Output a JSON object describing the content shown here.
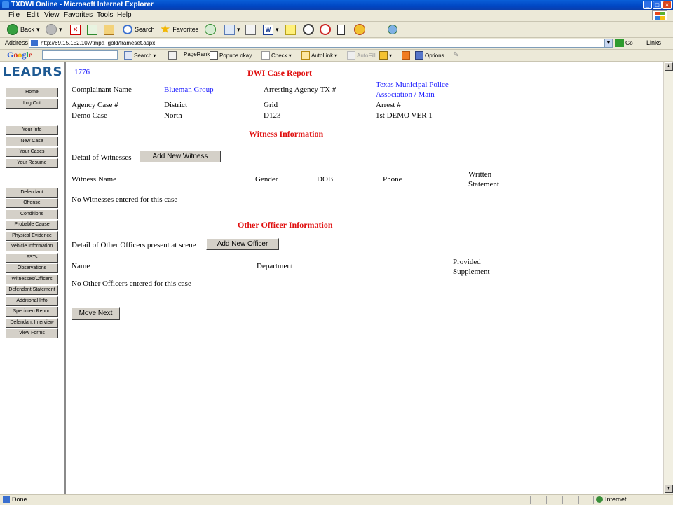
{
  "window": {
    "title": "TXDWI Online - Microsoft Internet Explorer",
    "min": "_",
    "max": "□",
    "close": "×"
  },
  "menu": [
    "File",
    "Edit",
    "View",
    "Favorites",
    "Tools",
    "Help"
  ],
  "toolbar": {
    "back": "Back",
    "search": "Search",
    "favorites": "Favorites"
  },
  "address": {
    "label": "Address",
    "url": "http://69.15.152.107/tmpa_gold/frameset.aspx",
    "go": "Go",
    "links": "Links"
  },
  "google_bar": {
    "logo": "Google",
    "search": "Search",
    "pagerank": "PageRank",
    "popups": "Popups okay",
    "check": "Check",
    "autolink": "AutoLink",
    "autofill": "AutoFill",
    "options": "Options"
  },
  "sidebar": {
    "logo": "LEADRS",
    "group1": [
      "Home",
      "Log Out"
    ],
    "group2": [
      "Your Info",
      "New Case",
      "Your Cases",
      "Your Resume"
    ],
    "group3": [
      "Defendant",
      "Offense",
      "Conditions",
      "Probable Cause",
      "Physical Evidence",
      "Vehicle Information",
      "FSTs",
      "Observations",
      "Witnesses/Officers",
      "Defendant Statement",
      "Additional Info",
      "Specimen Report",
      "Defendant Interview",
      "View Forms"
    ]
  },
  "report": {
    "case_number": "1776",
    "title": "DWI Case Report",
    "complainant_label": "Complainant Name",
    "complainant_value": "Blueman Group",
    "arresting_label": "Arresting Agency TX #",
    "arresting_value_line1": "Texas Municipal Police",
    "arresting_value_line2": "Association / Main",
    "agency_case_label": "Agency Case #",
    "district_label": "District",
    "grid_label": "Grid",
    "arrest_label": "Arrest #",
    "agency_case_value": "Demo Case",
    "district_value": "North",
    "grid_value": "D123",
    "arrest_value": "1st DEMO VER 1"
  },
  "witness": {
    "heading": "Witness Information",
    "detail_label": "Detail of Witnesses",
    "add_button": "Add New Witness",
    "col_name": "Witness Name",
    "col_gender": "Gender",
    "col_dob": "DOB",
    "col_phone": "Phone",
    "col_written_1": "Written",
    "col_written_2": "Statement",
    "empty": "No Witnesses entered for this case"
  },
  "officer": {
    "heading": "Other Officer Information",
    "detail_label": "Detail of Other Officers present at scene",
    "add_button": "Add New Officer",
    "col_name": "Name",
    "col_department": "Department",
    "col_provided_1": "Provided",
    "col_provided_2": "Supplement",
    "empty": "No Other Officers entered for this case"
  },
  "move_next": "Move Next",
  "status": {
    "text": "Done",
    "zone": "Internet"
  }
}
